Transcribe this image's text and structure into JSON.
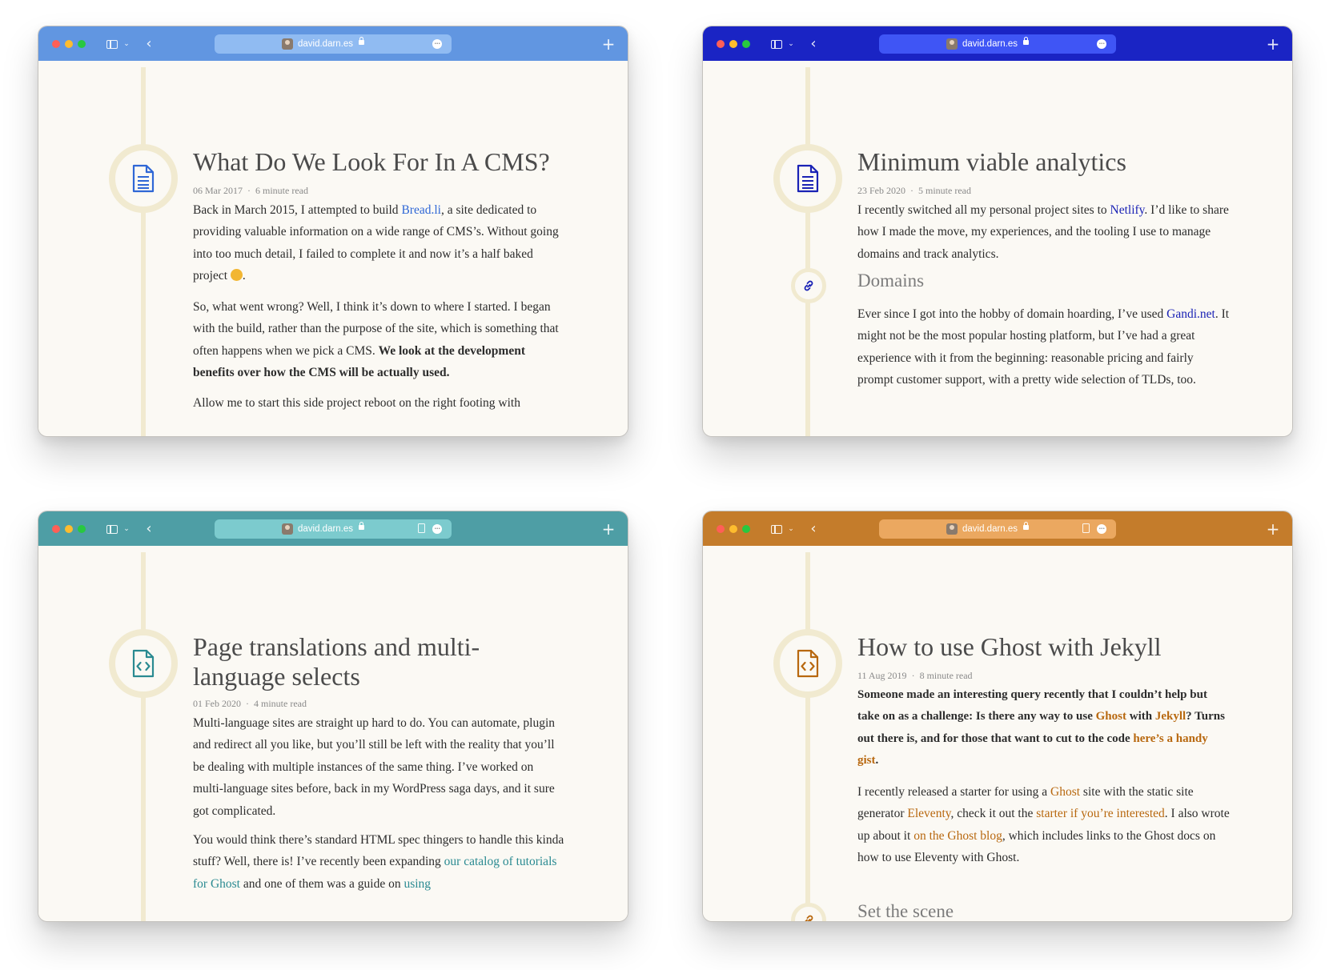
{
  "windows": [
    {
      "theme": {
        "bar": "#6196e1",
        "url_field": "#90bbf2",
        "accent": "#2f67d6"
      },
      "browser": {
        "url": "david.darn.es",
        "reader_icon": false
      },
      "post": {
        "icon": "document-icon",
        "title": "What Do We Look For In A CMS?",
        "date": "06 Mar 2017",
        "read_time": "6 minute read",
        "p1_a": "Back in March 2015, I attempted to build ",
        "p1_link": "Bread.li",
        "p1_b": ", a site dedicated to providing valuable information on a wide range of CMS’s. Without going into too much detail, I failed to complete it and now it’s a half baked project ",
        "p1_c": ".",
        "p2_a": "So, what went wrong? Well, I think it’s down to where I started. I began with the build, rather than the purpose of the site, which is something that often happens when we pick a CMS. ",
        "p2_bold": "We look at the development benefits over how the CMS will be actually used.",
        "p3": "Allow me to start this side project reboot on the right footing with"
      }
    },
    {
      "theme": {
        "bar": "#1a24c4",
        "url_field": "#3f55f5",
        "accent": "#1a22b5"
      },
      "browser": {
        "url": "david.darn.es",
        "reader_icon": false
      },
      "post": {
        "icon": "document-icon",
        "title": "Minimum viable analytics",
        "date": "23 Feb 2020",
        "read_time": "5 minute read",
        "p1_a": "I recently switched all my personal project sites to ",
        "p1_link": "Netlify",
        "p1_b": ". I’d like to share how I made the move, my experiences, and the tooling I use to manage domains and track analytics.",
        "heading": "Domains",
        "p2_a": "Ever since I got into the hobby of domain hoarding, I’ve used ",
        "p2_link": "Gandi.net",
        "p2_b": ". It might not be the most popular hosting platform, but I’ve had a great experience with it from the beginning: reasonable pricing and fairly prompt customer support, with a pretty wide selection of TLDs, too."
      }
    },
    {
      "theme": {
        "bar": "#4e9ea5",
        "url_field": "#7ccbce",
        "accent": "#2a8a91"
      },
      "browser": {
        "url": "david.darn.es",
        "reader_icon": true
      },
      "post": {
        "icon": "code-file-icon",
        "title": "Page translations and multi-language selects",
        "date": "01 Feb 2020",
        "read_time": "4 minute read",
        "p1": "Multi-language sites are straight up hard to do. You can automate, plugin and redirect all you like, but you’ll still be left with the reality that you’ll be dealing with multiple instances of the same thing. I’ve worked on multi-language sites before, back in my WordPress saga days, and it sure got complicated.",
        "p2_a": "You would think there’s standard HTML spec thingers to handle this kinda stuff? Well, there is! I’ve recently been expanding ",
        "p2_link1": "our catalog of tutorials for Ghost",
        "p2_b": " and one of them was a guide on ",
        "p2_link2": "using"
      }
    },
    {
      "theme": {
        "bar": "#c47c2b",
        "url_field": "#eba860",
        "accent": "#b8680f"
      },
      "browser": {
        "url": "david.darn.es",
        "reader_icon": true
      },
      "post": {
        "icon": "code-file-icon",
        "title": "How to use Ghost with Jekyll",
        "date": "11 Aug 2019",
        "read_time": "8 minute read",
        "p1_a": "Someone made an interesting query recently that I couldn’t help but take on as a challenge: Is there any way to use ",
        "p1_link1": "Ghost",
        "p1_b": " with ",
        "p1_link2": "Jekyll",
        "p1_c": "? Turns out there is, and for those that want to cut to the code ",
        "p1_link3": "here’s a handy gist",
        "p1_d": ".",
        "p2_a": "I recently released a starter for using a ",
        "p2_link1": "Ghost",
        "p2_b": " site with the static site generator ",
        "p2_link2": "Eleventy",
        "p2_c": ", check it out the ",
        "p2_link3": "starter if you’re interested",
        "p2_d": ". I also wrote up about it ",
        "p2_link4": "on the Ghost blog",
        "p2_e": ", which includes links to the Ghost docs on how to use Eleventy with Ghost.",
        "heading": "Set the scene"
      }
    }
  ]
}
